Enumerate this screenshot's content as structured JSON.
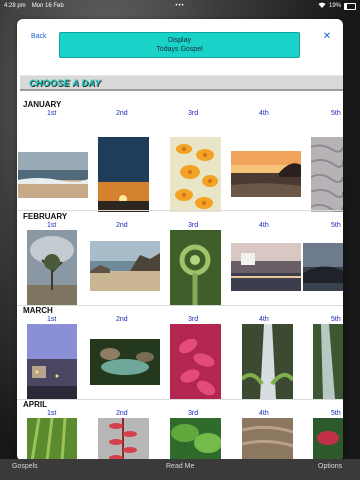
{
  "status_bar": {
    "time": "4:28 pm",
    "date": "Mon 16 Feb",
    "dots": "•••",
    "battery": "19%"
  },
  "header": {
    "back_label": "Back",
    "display_line1": "Display",
    "display_line2": "Todays Gospel",
    "close_icon": "close-icon"
  },
  "section_title": "CHOOSE A DAY",
  "months": [
    {
      "name": "JANUARY",
      "days": [
        "1st",
        "2nd",
        "3rd",
        "4th",
        "5th"
      ]
    },
    {
      "name": "FEBRUARY",
      "days": [
        "1st",
        "2nd",
        "3rd",
        "4th",
        "5th"
      ]
    },
    {
      "name": "MARCH",
      "days": [
        "1st",
        "2nd",
        "3rd",
        "4th",
        "5th"
      ]
    },
    {
      "name": "APRIL",
      "days": [
        "1st",
        "2nd",
        "3rd",
        "4th",
        "5th"
      ]
    }
  ],
  "thumbnails": {
    "january": [
      "beach-waves",
      "sunset-horizon",
      "orange-orchids",
      "sunset-headland",
      "rippled-sand"
    ],
    "february": [
      "storm-clouds-tree",
      "coastal-rocks",
      "fern-frond",
      "lagoon-sunset",
      "headland-dusk"
    ],
    "march": [
      "town-at-dusk",
      "rock-pool-stream",
      "pink-flower",
      "waterfall-ferns",
      "mossy-stream"
    ],
    "april": [
      "palm-fronds",
      "red-leaf-stem",
      "green-leaves",
      "sand-ripples",
      "red-tropical-leaves"
    ]
  },
  "tabbar": {
    "left_label": "Gospels",
    "center_label": "Read Me",
    "right_label": "Options"
  },
  "colors": {
    "accent_blue": "#1a63d9",
    "display_button": "#19d3c8",
    "section_title": "#19c9bc",
    "day_label": "#1a2bb5"
  }
}
